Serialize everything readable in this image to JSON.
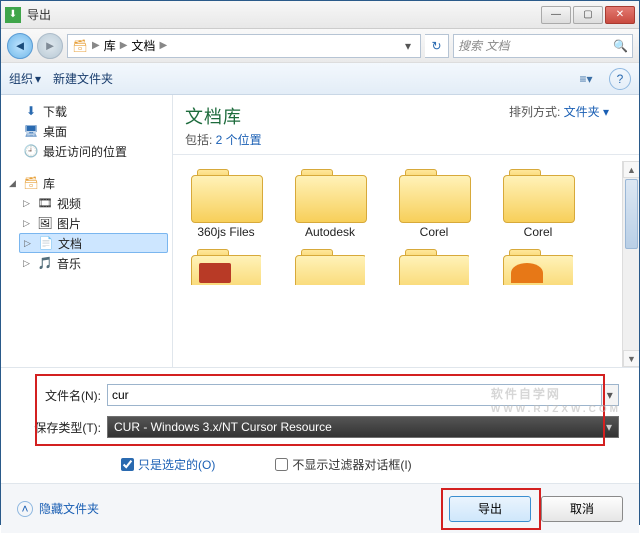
{
  "title": "导出",
  "breadcrumb": {
    "root": "库",
    "current": "文档"
  },
  "search": {
    "placeholder": "搜索 文档"
  },
  "toolbar": {
    "organize": "组织",
    "newfolder": "新建文件夹"
  },
  "sidebar": {
    "favorites": [
      {
        "label": "下载"
      },
      {
        "label": "桌面"
      },
      {
        "label": "最近访问的位置"
      }
    ],
    "libs_label": "库",
    "libs": [
      {
        "label": "视频"
      },
      {
        "label": "图片"
      },
      {
        "label": "文档",
        "selected": true
      },
      {
        "label": "音乐"
      }
    ]
  },
  "libheader": {
    "title": "文档库",
    "subtitle_prefix": "包括: ",
    "subtitle_link": "2 个位置"
  },
  "sort": {
    "label": "排列方式:",
    "value": "文件夹"
  },
  "folders": [
    {
      "name": "360js Files"
    },
    {
      "name": "Autodesk"
    },
    {
      "name": "Corel"
    },
    {
      "name": "Corel"
    }
  ],
  "form": {
    "filename_label": "文件名(N):",
    "filename_value": "cur",
    "filetype_label": "保存类型(T):",
    "filetype_value": "CUR - Windows 3.x/NT Cursor Resource",
    "only_selected": "只是选定的(O)",
    "no_filter_dialog": "不显示过滤器对话框(I)"
  },
  "footer": {
    "hide_folders": "隐藏文件夹",
    "export": "导出",
    "cancel": "取消"
  },
  "watermark": {
    "l1": "软件自学网",
    "l2": "WWW.RJZXW.COM"
  }
}
